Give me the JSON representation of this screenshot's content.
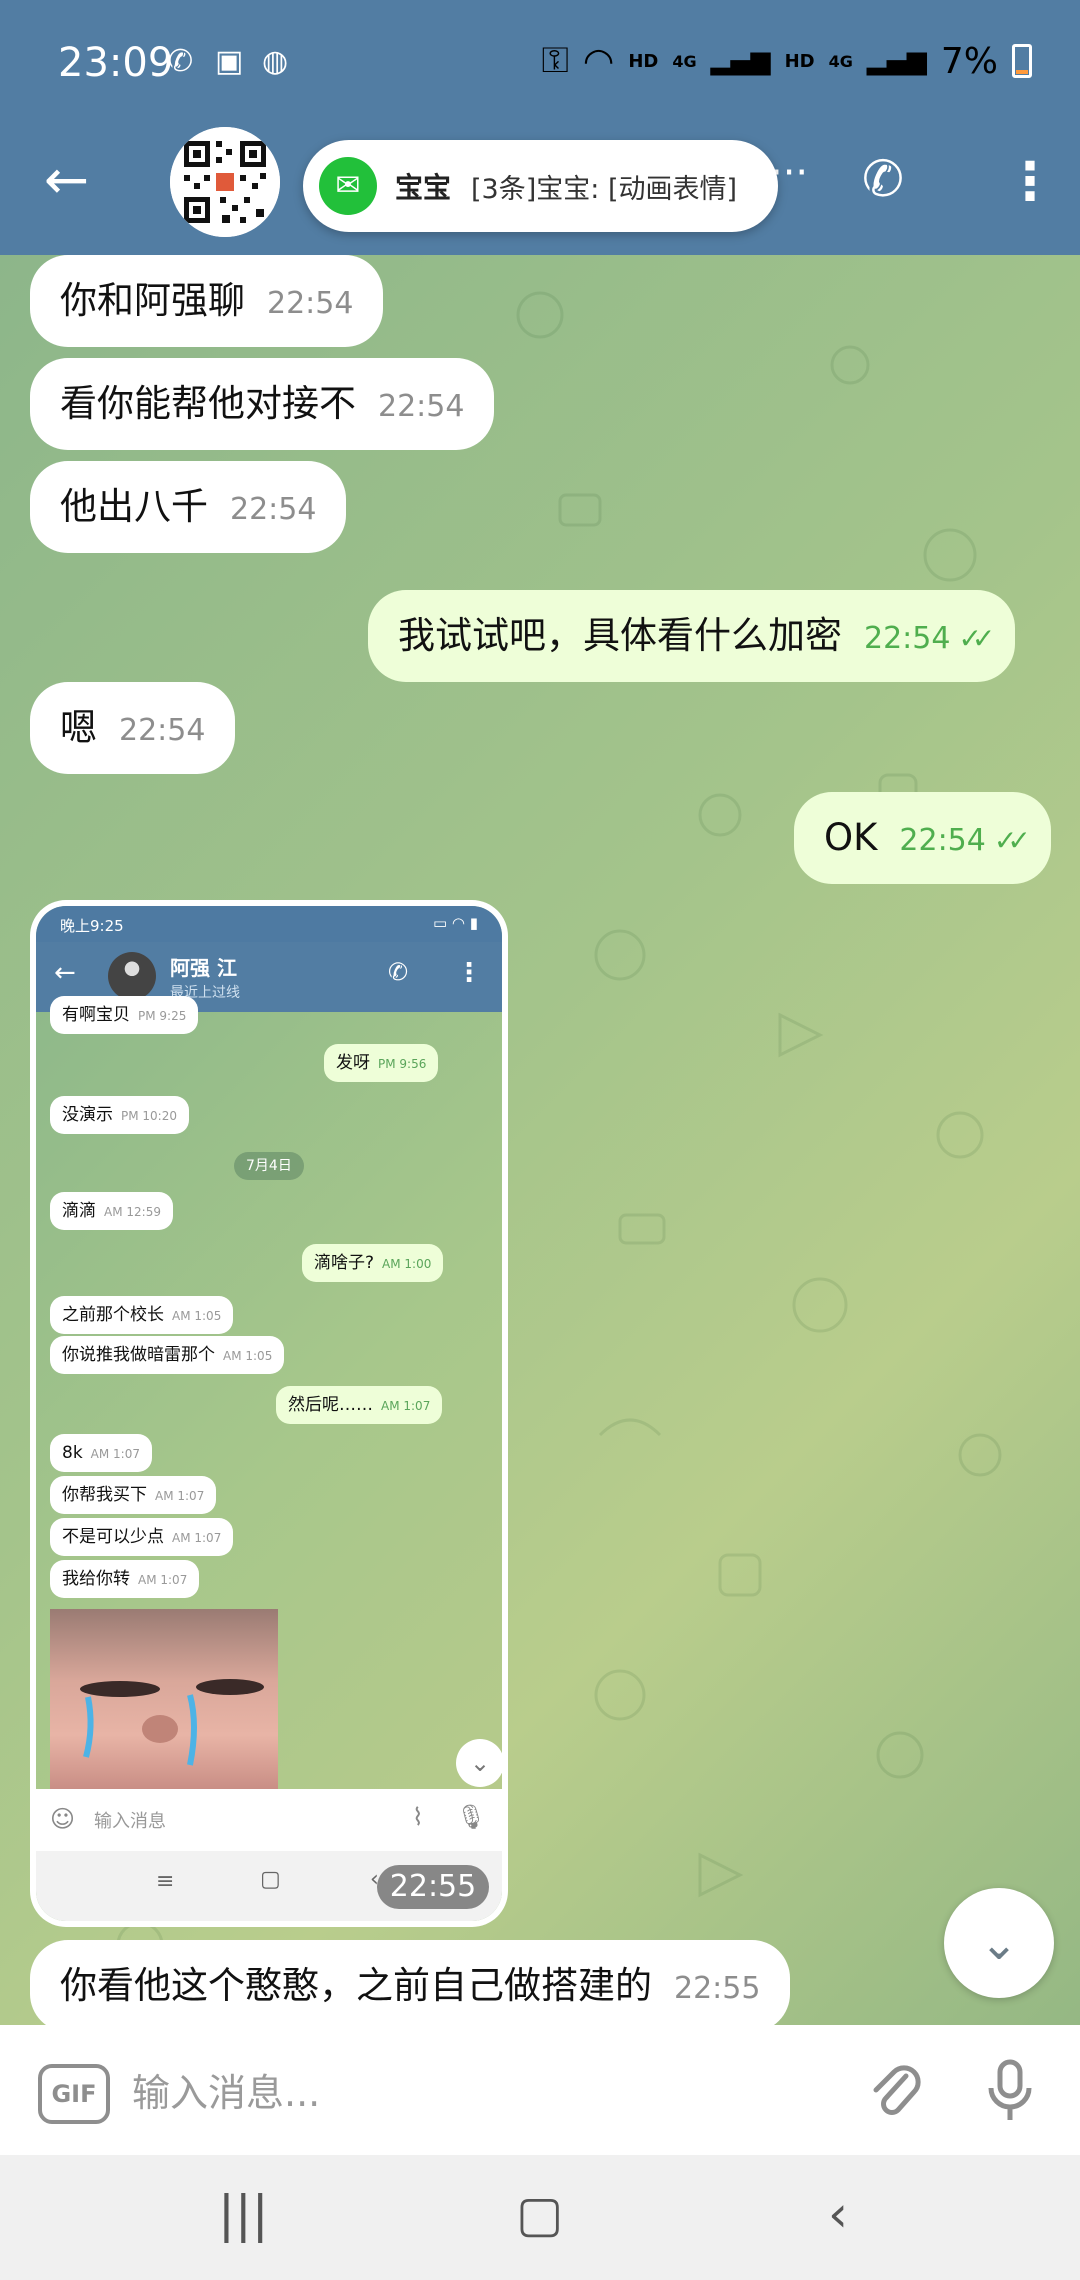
{
  "status": {
    "time": "23:09",
    "battery": "7%",
    "hd1": "HD",
    "net1": "4G",
    "hd2": "HD",
    "net2": "4G"
  },
  "header": {
    "title_overflow": "···"
  },
  "notification": {
    "sender": "宝宝",
    "message": "[3条]宝宝: [动画表情]"
  },
  "messages": [
    {
      "dir": "in",
      "text": "你和阿强聊",
      "time": "22:54"
    },
    {
      "dir": "in",
      "text": "看你能帮他对接不",
      "time": "22:54"
    },
    {
      "dir": "in",
      "text": "他出八千",
      "time": "22:54"
    },
    {
      "dir": "out",
      "text": "我试试吧，具体看什么加密",
      "time": "22:54"
    },
    {
      "dir": "in",
      "text": "嗯",
      "time": "22:54"
    },
    {
      "dir": "out",
      "text": "OK",
      "time": "22:54"
    },
    {
      "dir": "in",
      "text": "你看他这个憨憨，之前自己做搭建的",
      "time": "22:55"
    }
  ],
  "screenshot": {
    "time": "22:55",
    "status_time": "晚上9:25",
    "contact_name": "阿强 江",
    "contact_status": "最近上过线",
    "date_divider": "7月4日",
    "input_placeholder": "输入消息",
    "messages": [
      {
        "dir": "in",
        "text": "有啊宝贝",
        "time": "PM 9:25"
      },
      {
        "dir": "out",
        "text": "发呀",
        "time": "PM 9:56"
      },
      {
        "dir": "in",
        "text": "没演示",
        "time": "PM 10:20"
      },
      {
        "dir": "in",
        "text": "滴滴",
        "time": "AM 12:59"
      },
      {
        "dir": "out",
        "text": "滴啥子?",
        "time": "AM 1:00"
      },
      {
        "dir": "in",
        "text": "之前那个校长",
        "time": "AM 1:05"
      },
      {
        "dir": "in",
        "text": "你说推我做暗雷那个",
        "time": "AM 1:05"
      },
      {
        "dir": "out",
        "text": "然后呢……",
        "time": "AM 1:07"
      },
      {
        "dir": "in",
        "text": "8k",
        "time": "AM 1:07"
      },
      {
        "dir": "in",
        "text": "你帮我买下",
        "time": "AM 1:07"
      },
      {
        "dir": "in",
        "text": "不是可以少点",
        "time": "AM 1:07"
      },
      {
        "dir": "in",
        "text": "我给你转",
        "time": "AM 1:07"
      }
    ]
  },
  "input": {
    "placeholder": "输入消息...",
    "gif_label": "GIF"
  },
  "icons": {
    "back": "arrow-left-icon",
    "call": "phone-icon",
    "menu": "more-vertical-icon",
    "attach": "paperclip-icon",
    "mic": "microphone-icon",
    "scroll": "chevron-down-icon"
  },
  "colors": {
    "header": "#527da3",
    "incoming": "#ffffff",
    "outgoing": "#eefed8",
    "accent_green": "#4fae4e"
  }
}
